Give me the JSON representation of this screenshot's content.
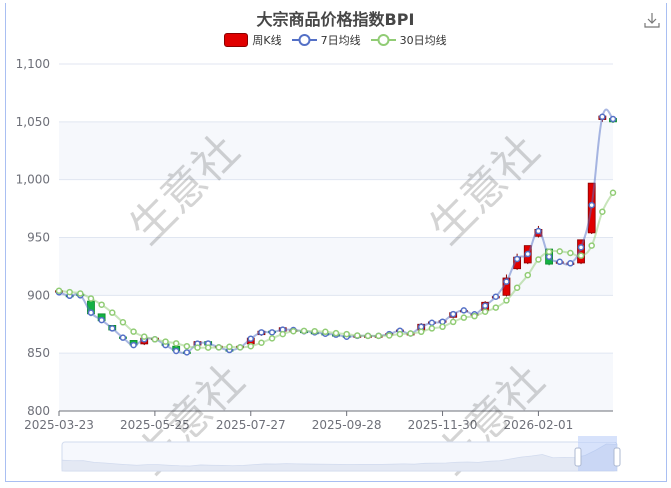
{
  "title": "大宗商品价格指数BPI",
  "legend": [
    {
      "label": "周K线",
      "color": "#e00000"
    },
    {
      "label": "7日均线",
      "color": "#5470c6"
    },
    {
      "label": "30日均线",
      "color": "#91cc75"
    }
  ],
  "watermark": "生意社",
  "toolbox": {
    "icon": "download-icon"
  },
  "colors": {
    "up": "#e00000",
    "up_border": "#8a0000",
    "down": "#14b143",
    "down_border": "#0a8a2a",
    "ma7": "#5470c6",
    "ma30": "#91cc75"
  },
  "chart_data": {
    "type": "candlestick",
    "title": "大宗商品价格指数BPI",
    "ylim": [
      800,
      1100
    ],
    "yticks": [
      "800",
      "850",
      "900",
      "950",
      "1,000",
      "1,050",
      "1,100"
    ],
    "ytick_values": [
      800,
      850,
      900,
      950,
      1000,
      1050,
      1100
    ],
    "xtick_labels": [
      "2025-03-23",
      "2025-05-25",
      "2025-07-27",
      "2025-09-28",
      "2025-11-30",
      "2026-02-01"
    ],
    "xtick_interval": 9,
    "grid": true,
    "legend_position": "top-center",
    "categories": [
      "2025-03-23",
      "2025-03-30",
      "2025-04-06",
      "2025-04-13",
      "2025-04-20",
      "2025-04-27",
      "2025-05-04",
      "2025-05-11",
      "2025-05-18",
      "2025-05-25",
      "2025-06-01",
      "2025-06-08",
      "2025-06-15",
      "2025-06-22",
      "2025-06-29",
      "2025-07-06",
      "2025-07-13",
      "2025-07-20",
      "2025-07-27",
      "2025-08-03",
      "2025-08-10",
      "2025-08-17",
      "2025-08-24",
      "2025-08-31",
      "2025-09-07",
      "2025-09-14",
      "2025-09-21",
      "2025-09-28",
      "2025-10-05",
      "2025-10-12",
      "2025-10-19",
      "2025-10-26",
      "2025-11-02",
      "2025-11-09",
      "2025-11-16",
      "2025-11-23",
      "2025-11-30",
      "2025-12-07",
      "2025-12-14",
      "2025-12-21",
      "2025-12-28",
      "2026-01-04",
      "2026-01-11",
      "2026-01-18",
      "2026-01-25",
      "2026-02-01",
      "2026-02-08",
      "2026-02-15",
      "2026-02-22",
      "2026-03-01",
      "2026-03-08",
      "2026-03-15",
      "2026-03-22"
    ],
    "ohlc_format": [
      "open",
      "close",
      "low",
      "high"
    ],
    "kline": [
      [
        903,
        904,
        902,
        905
      ],
      [
        900,
        899,
        898,
        901
      ],
      [
        901,
        900,
        899,
        901
      ],
      [
        895,
        884,
        882,
        895
      ],
      [
        884,
        878,
        877,
        884
      ],
      [
        874,
        870,
        869,
        874
      ],
      [
        864,
        863,
        862,
        865
      ],
      [
        861,
        857,
        856,
        861
      ],
      [
        858,
        863,
        857,
        864
      ],
      [
        862,
        863,
        861,
        863
      ],
      [
        858,
        857,
        856,
        858
      ],
      [
        856,
        852,
        851,
        856
      ],
      [
        851,
        850,
        849,
        852
      ],
      [
        857,
        860,
        856,
        860
      ],
      [
        860,
        857,
        856,
        860
      ],
      [
        855,
        856,
        854,
        856
      ],
      [
        853,
        852,
        851,
        853
      ],
      [
        855,
        856,
        854,
        856
      ],
      [
        858,
        863,
        857,
        864
      ],
      [
        866,
        869,
        865,
        869
      ],
      [
        869,
        868,
        867,
        869
      ],
      [
        869,
        872,
        868,
        872
      ],
      [
        870,
        870,
        869,
        871
      ],
      [
        869,
        868,
        868,
        870
      ],
      [
        868,
        867,
        866,
        868
      ],
      [
        867,
        866,
        865,
        867
      ],
      [
        866,
        865,
        864,
        866
      ],
      [
        865,
        864,
        863,
        865
      ],
      [
        865,
        865,
        864,
        866
      ],
      [
        865,
        865,
        864,
        866
      ],
      [
        865,
        865,
        864,
        866
      ],
      [
        866,
        867,
        865,
        867
      ],
      [
        869,
        870,
        868,
        871
      ],
      [
        866,
        867,
        866,
        868
      ],
      [
        870,
        875,
        869,
        876
      ],
      [
        876,
        877,
        875,
        877
      ],
      [
        877,
        878,
        876,
        878
      ],
      [
        881,
        885,
        880,
        886
      ],
      [
        887,
        887,
        886,
        888
      ],
      [
        884,
        884,
        883,
        885
      ],
      [
        887,
        894,
        886,
        895
      ],
      [
        898,
        899,
        897,
        900
      ],
      [
        900,
        915,
        899,
        918
      ],
      [
        923,
        933,
        922,
        936
      ],
      [
        928,
        943,
        927,
        943
      ],
      [
        951,
        957,
        950,
        960
      ],
      [
        940,
        927,
        926,
        940
      ],
      [
        929,
        929,
        928,
        930
      ],
      [
        928,
        928,
        927,
        929
      ],
      [
        928,
        948,
        927,
        948
      ],
      [
        954,
        997,
        953,
        997
      ],
      [
        1052,
        1055,
        1050,
        1057
      ],
      [
        1053,
        1050,
        1049,
        1053
      ]
    ],
    "series": [
      {
        "name": "7日均线",
        "values": [
          902.6,
          899.6,
          900,
          885,
          878.6,
          871.4,
          863.4,
          857,
          862,
          862,
          857,
          851.9,
          850.7,
          858.2,
          858.4,
          855,
          852.7,
          855,
          862.5,
          868,
          868,
          870.3,
          870,
          869,
          868,
          866.8,
          866,
          864.2,
          865,
          865,
          865,
          866.5,
          869.4,
          867,
          872.8,
          876.3,
          877.2,
          883.8,
          887,
          883.6,
          891,
          898.8,
          911.8,
          931.4,
          935.7,
          955.6,
          933.4,
          929,
          927.7,
          941.5,
          978,
          1054.4,
          1052.4
        ]
      },
      {
        "name": "30日均线",
        "values": [
          904,
          902.8,
          901.6,
          897.3,
          891.9,
          885,
          876.7,
          868.6,
          864.3,
          862,
          860,
          858.5,
          856,
          854.8,
          854.8,
          855,
          855.5,
          855,
          856,
          859,
          862.8,
          866.5,
          869,
          869.3,
          869,
          868.5,
          867.3,
          866.5,
          865.3,
          865,
          865,
          865.3,
          866.5,
          867,
          868.5,
          871.4,
          872.8,
          877,
          880.7,
          882,
          885.8,
          889.4,
          895.6,
          906.6,
          917.5,
          931,
          937.7,
          938,
          936.6,
          934.3,
          943,
          972.3,
          988.7
        ]
      }
    ]
  }
}
